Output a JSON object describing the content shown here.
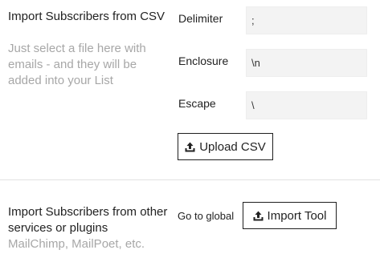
{
  "csv_section": {
    "title": "Import Subscribers from CSV",
    "description": "Just select a file here with emails - and they will be added into your List",
    "fields": [
      {
        "label": "Delimiter",
        "value": ";"
      },
      {
        "label": "Enclosure",
        "value": "\\n"
      },
      {
        "label": "Escape",
        "value": "\\"
      }
    ],
    "upload_button": {
      "label": "Upload CSV",
      "icon": "upload-icon"
    }
  },
  "plugins_section": {
    "title": "Import Subscribers from other services or plugins",
    "description": "MailChimp, MailPoet, etc.",
    "go_to_text": "Go to global",
    "import_tool_button": {
      "label": "Import Tool",
      "icon": "upload-icon"
    }
  },
  "colors": {
    "description_text": "#a7a7a7",
    "input_background": "#f3f3f3",
    "button_border": "#1f1f1f",
    "divider": "#e2e2e2"
  }
}
